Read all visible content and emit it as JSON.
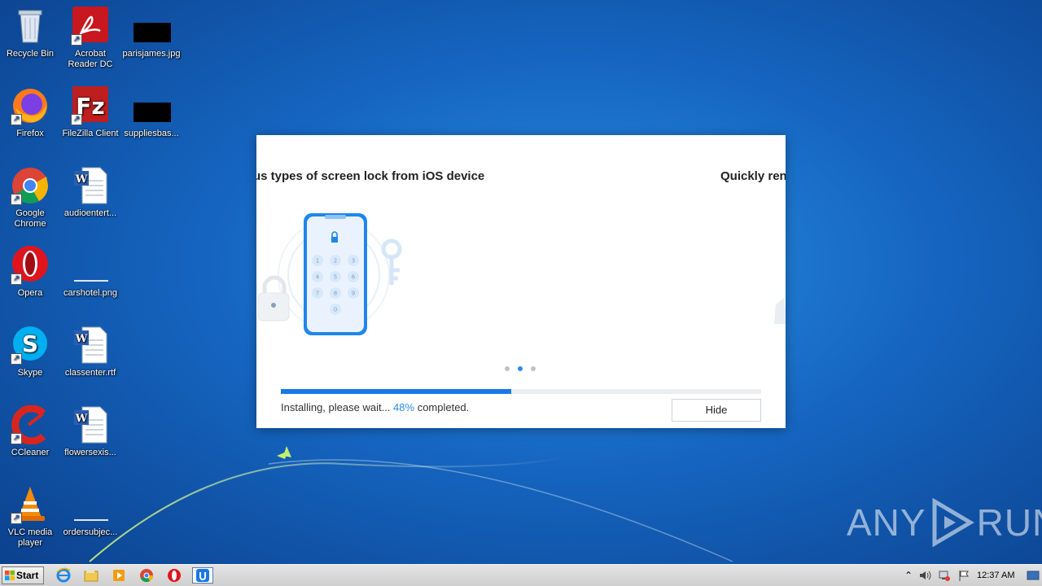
{
  "desktop": {
    "icons": [
      {
        "label": "Recycle Bin"
      },
      {
        "label": "Acrobat Reader DC"
      },
      {
        "label": "parisjames.jpg"
      },
      {
        "label": "Firefox"
      },
      {
        "label": "FileZilla Client"
      },
      {
        "label": "suppliesbas..."
      },
      {
        "label": "Google Chrome"
      },
      {
        "label": "audioentert..."
      },
      {
        "label": "Opera"
      },
      {
        "label": "carshotel.png"
      },
      {
        "label": "Skype"
      },
      {
        "label": "classenter.rtf"
      },
      {
        "label": "CCleaner"
      },
      {
        "label": "flowersexis..."
      },
      {
        "label": "VLC media player"
      },
      {
        "label": "ordersubjec..."
      }
    ]
  },
  "dialog": {
    "slide_title_left": "us types of screen lock from iOS device",
    "slide_title_right": "Quickly ren",
    "keypad": [
      "1",
      "2",
      "3",
      "4",
      "5",
      "6",
      "7",
      "8",
      "9",
      "0"
    ],
    "progress_percent": 48,
    "status_prefix": "Installing, please wait...",
    "status_percent": "48%",
    "status_suffix": "completed.",
    "hide_label": "Hide",
    "active_dot": 1
  },
  "watermark": {
    "left": "ANY",
    "right": "RUN"
  },
  "taskbar": {
    "start_label": "Start",
    "clock": "12:37 AM"
  },
  "colors": {
    "accent": "#2d8cf0",
    "progress": "#1a78e6",
    "desktop": "#1565c0"
  }
}
